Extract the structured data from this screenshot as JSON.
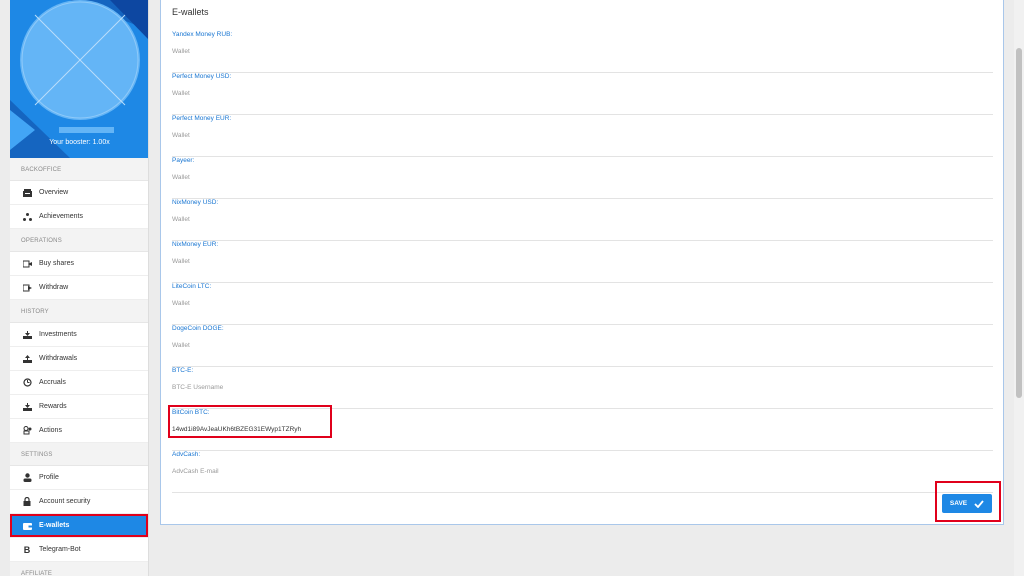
{
  "sidebar": {
    "booster_text": "Your booster: 1.00x",
    "sections": {
      "backoffice": "BACKOFFICE",
      "operations": "OPERATIONS",
      "history": "HISTORY",
      "settings": "SETTINGS",
      "affiliate": "AFFILIATE"
    },
    "items": {
      "overview": "Overview",
      "achievements": "Achievements",
      "buy_shares": "Buy shares",
      "withdraw": "Withdraw",
      "investments": "Investments",
      "withdrawals": "Withdrawals",
      "accruals": "Accruals",
      "rewards": "Rewards",
      "actions": "Actions",
      "profile": "Profile",
      "account_security": "Account security",
      "ewallets": "E-wallets",
      "telegram_bot": "Telegram-Bot"
    }
  },
  "main": {
    "title": "E-wallets",
    "fields": [
      {
        "label": "Yandex Money RUB:",
        "value": "",
        "placeholder": "Wallet"
      },
      {
        "label": "Perfect Money USD:",
        "value": "",
        "placeholder": "Wallet"
      },
      {
        "label": "Perfect Money EUR:",
        "value": "",
        "placeholder": "Wallet"
      },
      {
        "label": "Payeer:",
        "value": "",
        "placeholder": "Wallet"
      },
      {
        "label": "NixMoney USD:",
        "value": "",
        "placeholder": "Wallet"
      },
      {
        "label": "NixMoney EUR:",
        "value": "",
        "placeholder": "Wallet"
      },
      {
        "label": "LiteCoin LTC:",
        "value": "",
        "placeholder": "Wallet"
      },
      {
        "label": "DogeCoin DOGE:",
        "value": "",
        "placeholder": "Wallet"
      },
      {
        "label": "BTC-E:",
        "value": "",
        "placeholder": "BTC-E Username"
      },
      {
        "label": "BitCoin BTC:",
        "value": "14wd1i89AvJeaUKh6tBZEG31EWyp1TZRyh",
        "placeholder": "Wallet"
      },
      {
        "label": "AdvCash:",
        "value": "",
        "placeholder": "AdvCash E-mail"
      }
    ],
    "save_label": "SAVE"
  },
  "colors": {
    "accent": "#1e88e5",
    "highlight": "#e0001b",
    "label": "#1976d2"
  },
  "icons": {
    "overview": "inbox-icon",
    "achievements": "network-icon",
    "buy_shares": "cart-in-icon",
    "withdraw": "cart-out-icon",
    "investments": "download-tray-icon",
    "withdrawals": "upload-tray-icon",
    "accruals": "history-icon",
    "rewards": "download-tray-icon",
    "actions": "users-icon",
    "profile": "user-icon",
    "account_security": "lock-icon",
    "ewallets": "wallet-icon",
    "telegram_bot": "b-icon",
    "save": "check-icon"
  }
}
